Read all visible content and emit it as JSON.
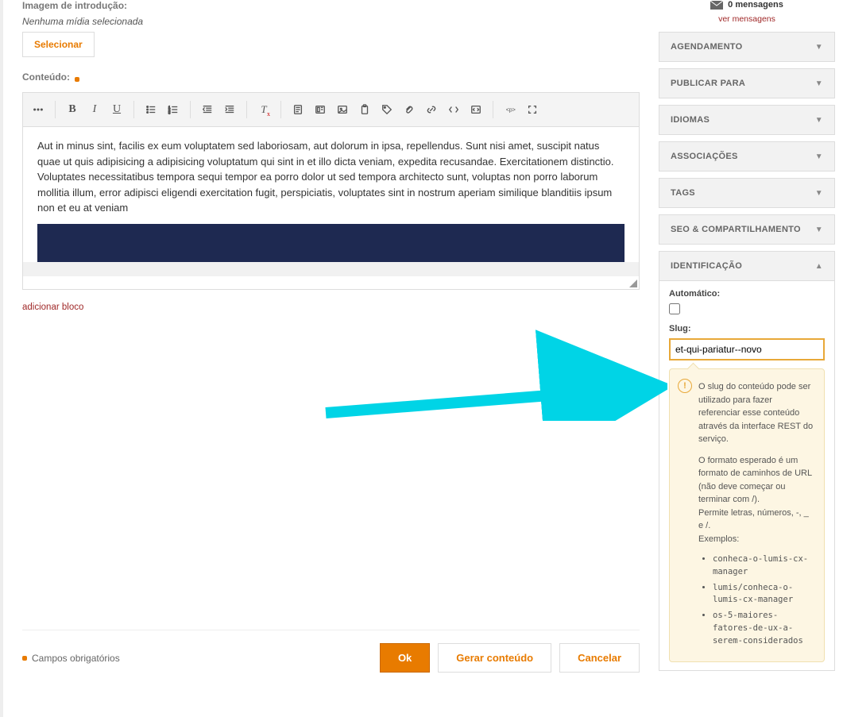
{
  "intro_image": {
    "label": "Imagem de introdução:",
    "status": "Nenhuma mídia selecionada",
    "select_button": "Selecionar"
  },
  "content": {
    "label": "Conteúdo:",
    "body_text": "Aut in minus sint, facilis ex eum voluptatem sed laboriosam, aut dolorum in ipsa, repellendus. Sunt nisi amet, suscipit natus quae ut quis adipisicing a adipisicing voluptatum qui sint in et illo dicta veniam, expedita recusandae. Exercitationem distinctio. Voluptates necessitatibus tempora sequi tempor ea porro dolor ut sed tempora architecto sunt, voluptas non porro laborum mollitia illum, error adipisci eligendi exercitation fugit, perspiciatis, voluptates sint in nostrum aperiam similique blanditiis ipsum non et eu at veniam"
  },
  "add_block_label": "adicionar bloco",
  "footer": {
    "required_label": "Campos obrigatórios",
    "ok": "Ok",
    "generate": "Gerar conteúdo",
    "cancel": "Cancelar"
  },
  "messages": {
    "count_label": "0 mensagens",
    "link": "ver mensagens"
  },
  "panels": {
    "agendamento": "AGENDAMENTO",
    "publicar_para": "PUBLICAR PARA",
    "idiomas": "IDIOMAS",
    "associacoes": "ASSOCIAÇÕES",
    "tags": "TAGS",
    "seo": "SEO & COMPARTILHAMENTO",
    "identificacao": "IDENTIFICAÇÃO"
  },
  "identification": {
    "auto_label": "Automático:",
    "slug_label": "Slug:",
    "slug_value": "et-qui-pariatur--novo",
    "help_p1": "O slug do conteúdo pode ser utilizado para fazer referenciar esse conteúdo através da interface REST do serviço.",
    "help_p2": "O formato esperado é um formato de caminhos de URL (não deve começar ou terminar com /).",
    "help_p3": "Permite letras, números, -, _ e /.",
    "help_examples_label": "Exemplos:",
    "examples": [
      "conheca-o-lumis-cx-manager",
      "lumis/conheca-o-lumis-cx-manager",
      "os-5-maiores-fatores-de-ux-a-serem-considerados"
    ]
  }
}
